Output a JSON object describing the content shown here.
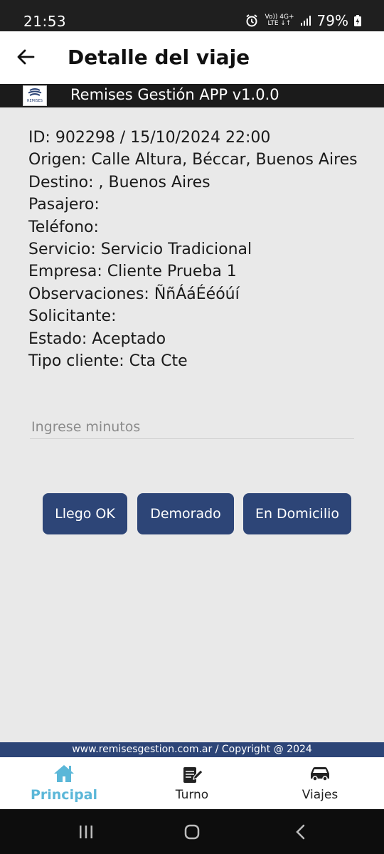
{
  "status_bar": {
    "time": "21:53",
    "battery": "79%",
    "net_top": "Vo)) 4G+",
    "net_bottom": "LTE ↓↑"
  },
  "appbar": {
    "title": "Detalle del viaje",
    "back_icon": "arrow-left-icon"
  },
  "brand": {
    "logo_text": "REMISES",
    "name": "Remises Gestión APP v1.0.0"
  },
  "details": [
    "ID: 902298 / 15/10/2024 22:00",
    "Origen: Calle Altura, Béccar, Buenos Aires",
    "Destino: , Buenos Aires",
    "Pasajero:",
    "Teléfono:",
    "Servicio: Servicio Tradicional",
    "Empresa: Cliente Prueba 1",
    "Observaciones: ÑñÁáÉéóúí",
    "Solicitante:",
    "Estado: Aceptado",
    "Tipo cliente: Cta Cte"
  ],
  "minutes_input": {
    "value": "",
    "placeholder": "Ingrese minutos"
  },
  "actions": {
    "llego_ok": "Llego OK",
    "demorado": "Demorado",
    "en_domicilio": "En Domicilio"
  },
  "footer": {
    "text": "www.remisesgestion.com.ar / Copyright @ 2024"
  },
  "bottom_nav": {
    "principal": "Principal",
    "turno": "Turno",
    "viajes": "Viajes",
    "active": "Principal"
  },
  "colors": {
    "primary": "#2d4577",
    "accent": "#5bb7d8",
    "background": "#e9e9e9",
    "brand_bar": "#1b1b1b"
  }
}
